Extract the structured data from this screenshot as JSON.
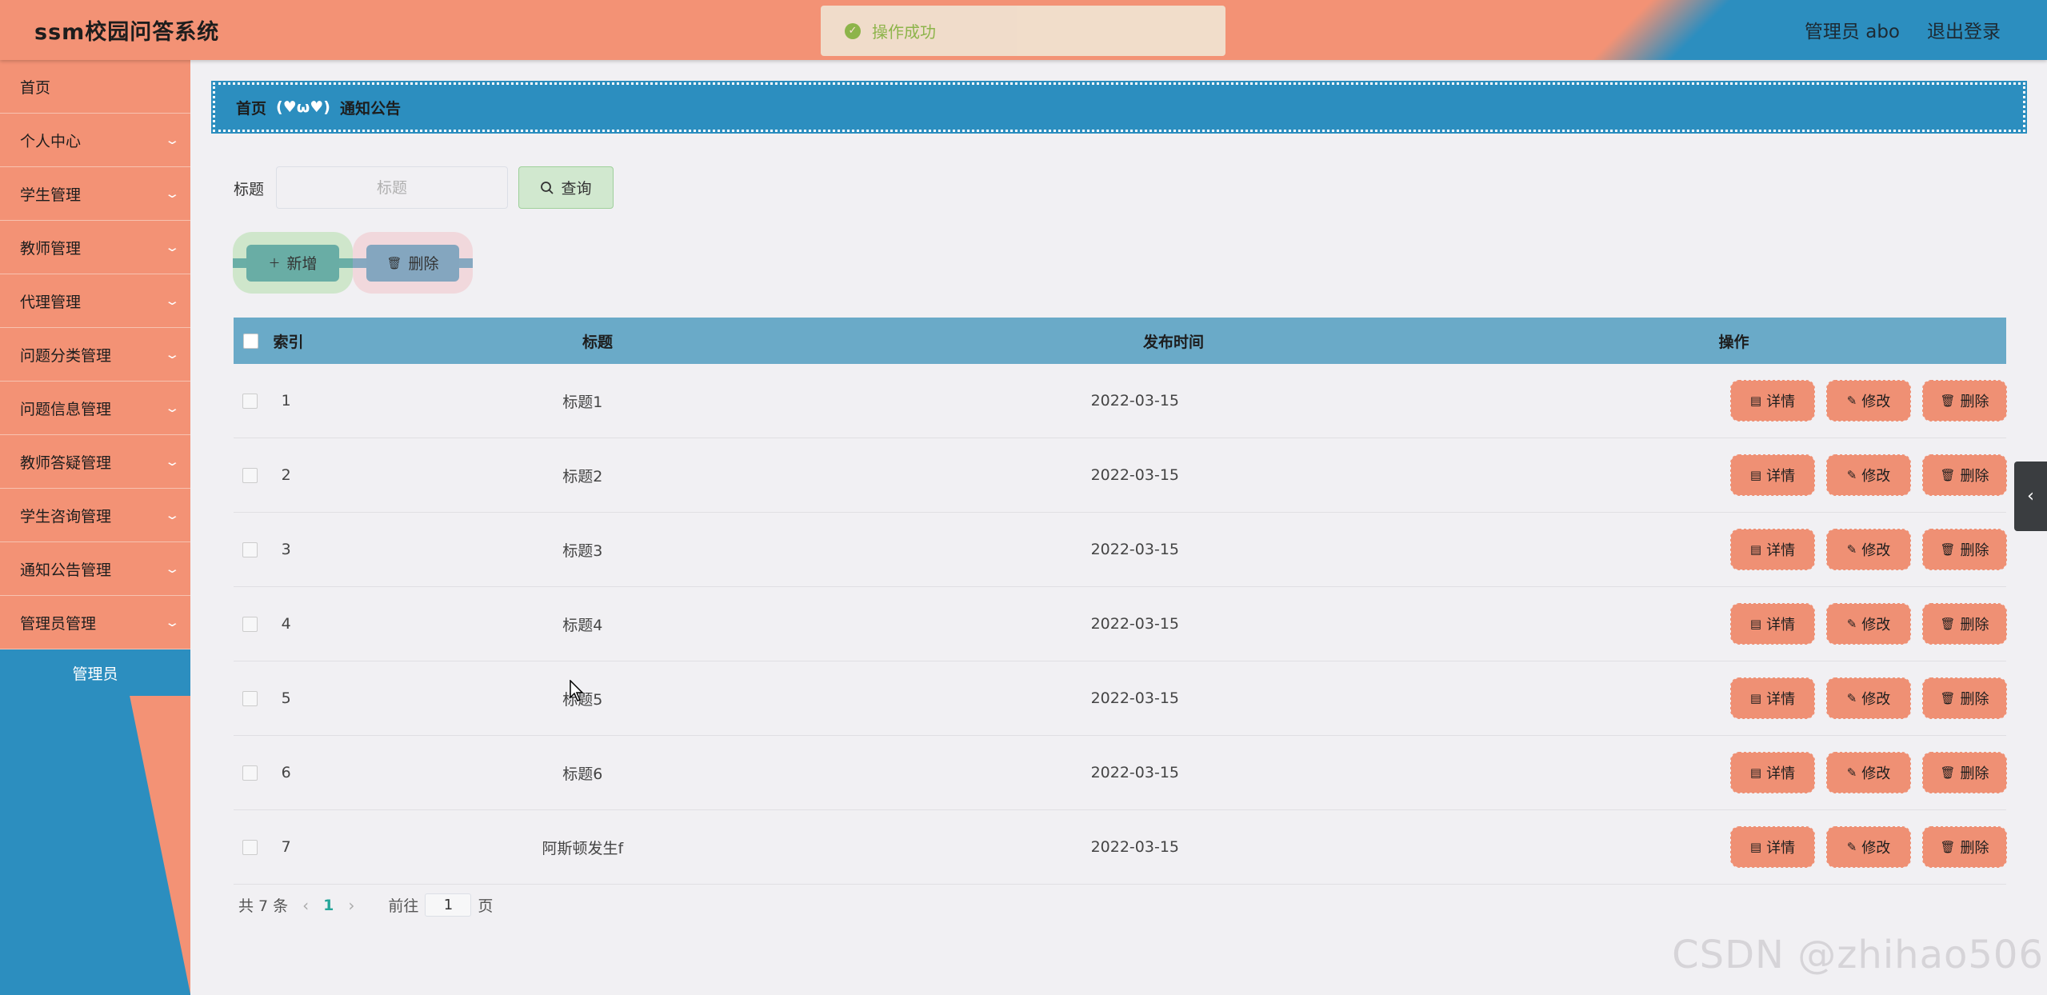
{
  "app": {
    "title": "ssm校园问答系统"
  },
  "header": {
    "user_label": "管理员 abo",
    "logout": "退出登录"
  },
  "toast": {
    "message": "操作成功"
  },
  "sidebar": {
    "items": [
      {
        "label": "首页",
        "has_submenu": false
      },
      {
        "label": "个人中心",
        "has_submenu": true
      },
      {
        "label": "学生管理",
        "has_submenu": true
      },
      {
        "label": "教师管理",
        "has_submenu": true
      },
      {
        "label": "代理管理",
        "has_submenu": true
      },
      {
        "label": "问题分类管理",
        "has_submenu": true
      },
      {
        "label": "问题信息管理",
        "has_submenu": true
      },
      {
        "label": "教师答疑管理",
        "has_submenu": true
      },
      {
        "label": "学生咨询管理",
        "has_submenu": true
      },
      {
        "label": "通知公告管理",
        "has_submenu": true
      },
      {
        "label": "管理员管理",
        "has_submenu": true
      }
    ],
    "active_subitem": "管理员"
  },
  "breadcrumb": {
    "home": "首页",
    "separator": "(♥ω♥)",
    "current": "通知公告"
  },
  "search": {
    "label": "标题",
    "placeholder": "标题",
    "value": "",
    "button": "查询"
  },
  "actions": {
    "add": "新增",
    "delete": "删除"
  },
  "table": {
    "headers": {
      "index": "索引",
      "title": "标题",
      "date": "发布时间",
      "ops": "操作"
    },
    "rows": [
      {
        "index": "1",
        "title": "标题1",
        "date": "2022-03-15"
      },
      {
        "index": "2",
        "title": "标题2",
        "date": "2022-03-15"
      },
      {
        "index": "3",
        "title": "标题3",
        "date": "2022-03-15"
      },
      {
        "index": "4",
        "title": "标题4",
        "date": "2022-03-15"
      },
      {
        "index": "5",
        "title": "标题5",
        "date": "2022-03-15"
      },
      {
        "index": "6",
        "title": "标题6",
        "date": "2022-03-15"
      },
      {
        "index": "7",
        "title": "阿斯顿发生f",
        "date": "2022-03-15"
      }
    ],
    "row_ops": {
      "detail": "详情",
      "edit": "修改",
      "delete": "删除"
    }
  },
  "pagination": {
    "total": "共 7 条",
    "current_page": "1",
    "goto_label": "前往",
    "goto_value": "1",
    "page_suffix": "页"
  },
  "watermark": "CSDN @zhihao506",
  "icons": {
    "toast": "success-check-icon",
    "search": "search-icon",
    "add": "plus-icon",
    "delete": "trash-icon",
    "detail": "document-icon",
    "edit": "pencil-icon",
    "chevron": "chevron-down-icon",
    "side_toggle": "chevron-left-icon"
  },
  "colors": {
    "primary": "#2c8ebf",
    "accent": "#f39275",
    "table_header": "#6aaac8",
    "page_active": "#26a69a"
  }
}
